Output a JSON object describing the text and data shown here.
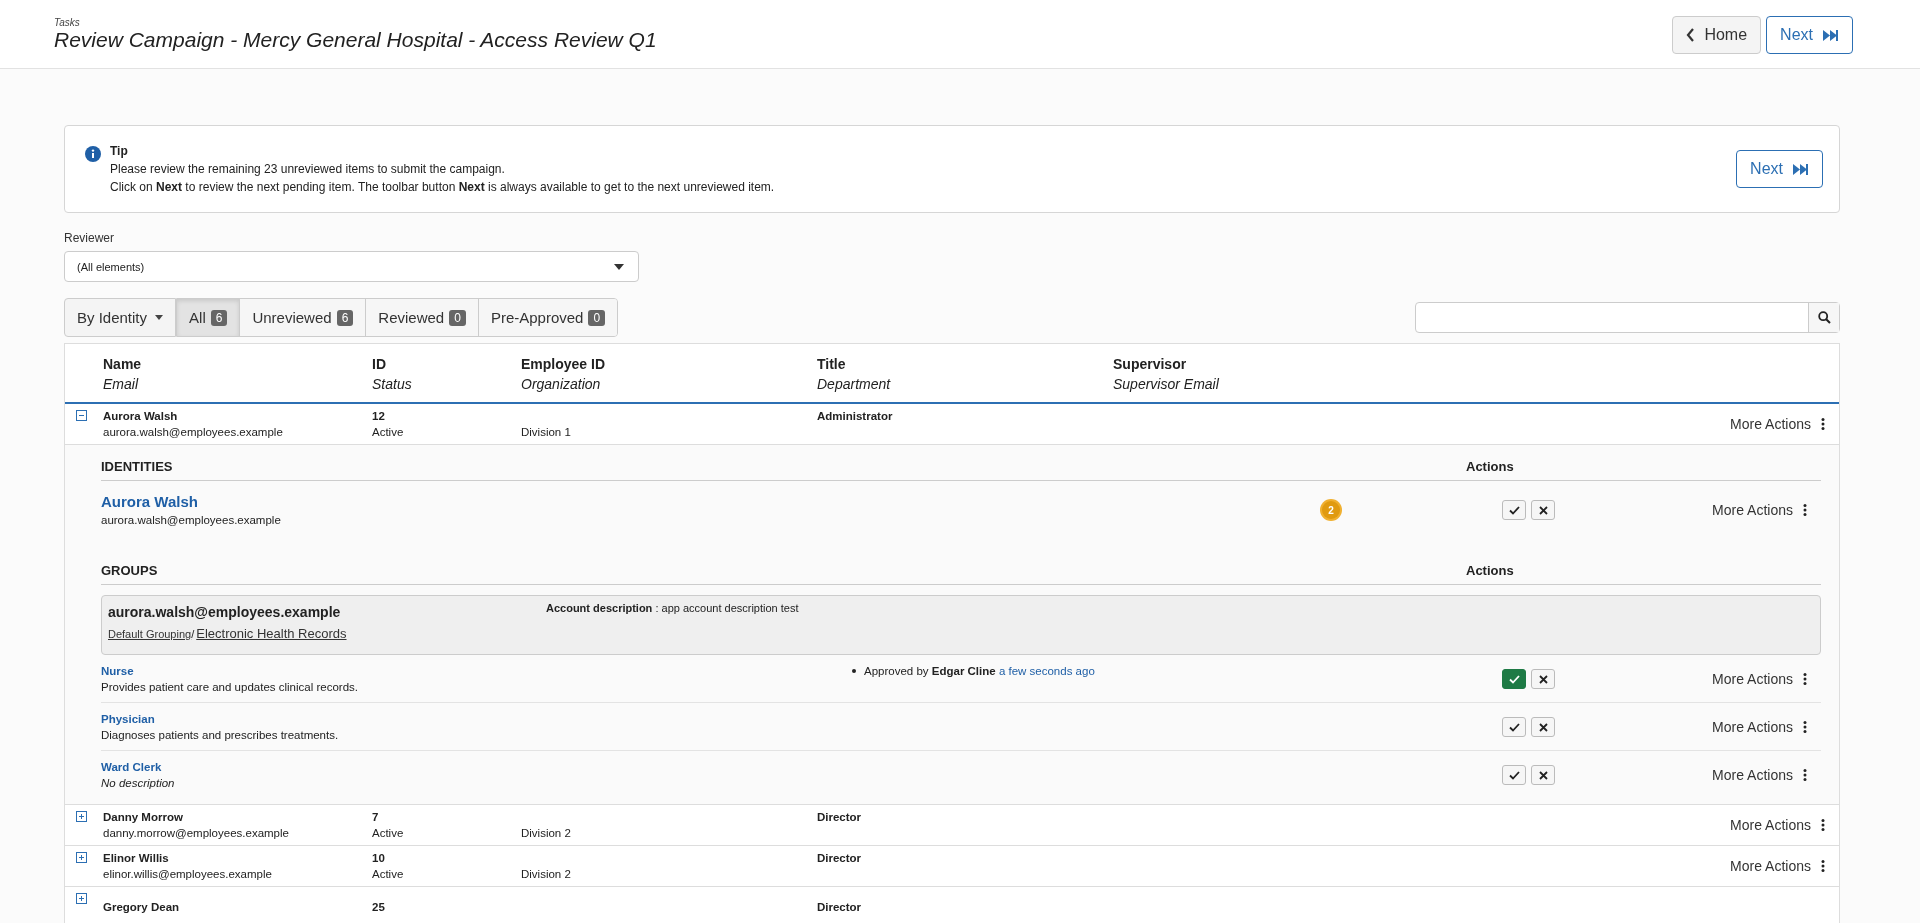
{
  "header": {
    "breadcrumb": "Tasks",
    "title": "Review Campaign - Mercy General Hospital - Access Review Q1",
    "buttons": [
      {
        "kind": "back",
        "label": "Home"
      },
      {
        "kind": "next",
        "label": "Next"
      }
    ]
  },
  "tip": {
    "title": "Tip",
    "lines": [
      "Please review the remaining 23 unreviewed items to submit the campaign.",
      "Click on **Next** to review the next pending item. The toolbar button **Next** is always available to get to the next unreviewed item."
    ],
    "button": "Next"
  },
  "reviewer": {
    "label": "Reviewer",
    "value": "(All elements)"
  },
  "grouping": "By Identity",
  "tabs": [
    {
      "label": "All",
      "count": "6",
      "selected": true
    },
    {
      "label": "Unreviewed",
      "count": "6",
      "selected": false
    },
    {
      "label": "Reviewed",
      "count": "0",
      "selected": false
    },
    {
      "label": "Pre-Approved",
      "count": "0",
      "selected": false
    }
  ],
  "columns": [
    {
      "title": "Name",
      "subtitle": "Email"
    },
    {
      "title": "ID",
      "subtitle": "Status"
    },
    {
      "title": "Employee ID",
      "subtitle": "Organization"
    },
    {
      "title": "Title",
      "subtitle": "Department"
    },
    {
      "title": "Supervisor",
      "subtitle": "Supervisor Email"
    }
  ],
  "rows": [
    {
      "name": "Aurora Walsh",
      "email": "aurora.walsh@employees.example",
      "id": "12",
      "status": "Active",
      "organization": "Division 1",
      "title": "Administrator",
      "expanded": true,
      "more_actions": "More Actions",
      "identities_heading": "IDENTITIES",
      "identities_actions_heading": "Actions",
      "identity": {
        "name": "Aurora Walsh",
        "email": "aurora.walsh@employees.example",
        "badge": "2",
        "approved": false,
        "more_actions": "More Actions"
      },
      "groups_heading": "GROUPS",
      "groups_actions_heading": "Actions",
      "account": {
        "name": "aurora.walsh@employees.example",
        "grouping": "Default Grouping",
        "separator": "/",
        "application": "Electronic Health Records",
        "description_label": "Account description",
        "description": ": app account description test"
      },
      "entitlements": [
        {
          "name": "Nurse",
          "description": "Provides patient care and updates clinical records.",
          "placeholder_description": false,
          "approved": true,
          "approval": {
            "prefix": "Approved by",
            "approver": "Edgar Cline",
            "time": "a few seconds ago"
          },
          "more_actions": "More Actions"
        },
        {
          "name": "Physician",
          "description": "Diagnoses patients and prescribes treatments.",
          "placeholder_description": false,
          "approved": false,
          "more_actions": "More Actions"
        },
        {
          "name": "Ward Clerk",
          "description": "No description",
          "placeholder_description": true,
          "approved": false,
          "more_actions": "More Actions"
        }
      ]
    },
    {
      "name": "Danny Morrow",
      "email": "danny.morrow@employees.example",
      "id": "7",
      "status": "Active",
      "organization": "Division 2",
      "title": "Director",
      "expanded": false,
      "more_actions": "More Actions"
    },
    {
      "name": "Elinor Willis",
      "email": "elinor.willis@employees.example",
      "id": "10",
      "status": "Active",
      "organization": "Division 2",
      "title": "Director",
      "expanded": false,
      "more_actions": "More Actions"
    },
    {
      "name": "Gregory Dean",
      "id": "25",
      "title": "Director",
      "expanded": false
    }
  ]
}
